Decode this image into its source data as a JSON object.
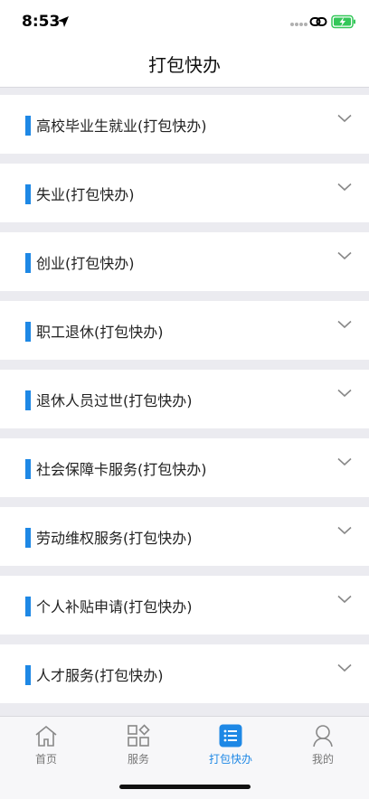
{
  "status_bar": {
    "time": "8:53",
    "icons": [
      "location-arrow-icon",
      "signal-dots-icon",
      "link-icon",
      "battery-charging-icon"
    ],
    "battery_color": "#34c759"
  },
  "header": {
    "title": "打包快办"
  },
  "items": [
    {
      "label": "高校毕业生就业(打包快办)"
    },
    {
      "label": "失业(打包快办)"
    },
    {
      "label": "创业(打包快办)"
    },
    {
      "label": "职工退休(打包快办)"
    },
    {
      "label": "退休人员过世(打包快办)"
    },
    {
      "label": "社会保障卡服务(打包快办)"
    },
    {
      "label": "劳动维权服务(打包快办)"
    },
    {
      "label": "个人补贴申请(打包快办)"
    },
    {
      "label": "人才服务(打包快办)"
    }
  ],
  "tabs": [
    {
      "label": "首页",
      "icon": "home-icon",
      "active": false
    },
    {
      "label": "服务",
      "icon": "grid-icon",
      "active": false
    },
    {
      "label": "打包快办",
      "icon": "list-icon",
      "active": true
    },
    {
      "label": "我的",
      "icon": "person-icon",
      "active": false
    }
  ],
  "colors": {
    "accent": "#1e88e5",
    "background": "#ebebf0"
  }
}
